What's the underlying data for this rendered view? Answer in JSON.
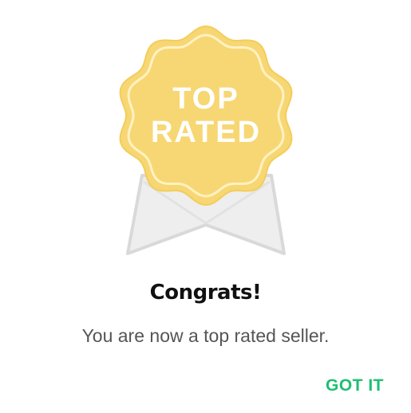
{
  "badge": {
    "line1": "TOP",
    "line2": "RATED",
    "colors": {
      "seal_fill": "#f7d774",
      "seal_inner": "#fbe08a",
      "ribbon_fill": "#eeeeee",
      "ribbon_stroke": "#d6d6d6",
      "text": "#ffffff"
    },
    "icon": "top-rated-badge-icon"
  },
  "dialog": {
    "title": "Congrats!",
    "message": "You are now a top rated seller.",
    "action_label": "GOT IT",
    "accent_color": "#1dbf73"
  }
}
